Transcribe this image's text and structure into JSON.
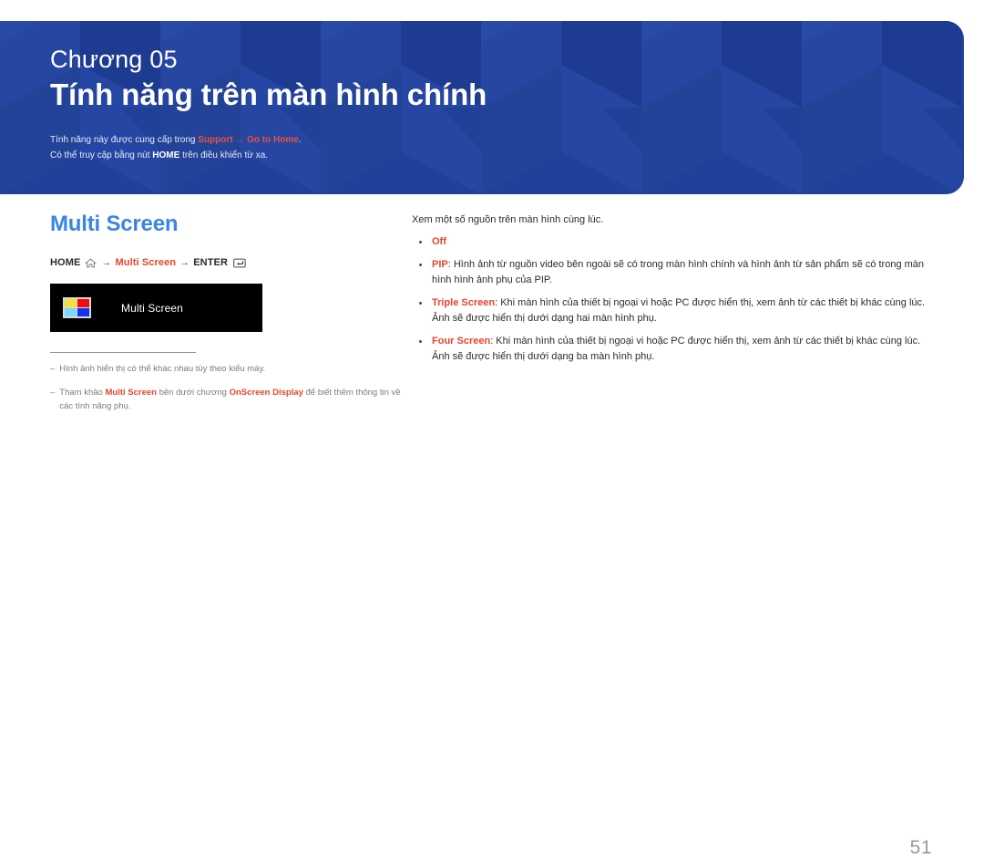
{
  "banner": {
    "chapter_label": "Chương 05",
    "chapter_title": "Tính năng trên màn hình chính",
    "note_line1_pre": "Tính năng này được cung cấp trong ",
    "note_line1_link1": "Support",
    "note_line1_arrow": " → ",
    "note_line1_link2": "Go to Home",
    "note_line1_post": ".",
    "note_line2_pre": "Có thể truy cập bằng nút ",
    "note_line2_bold": "HOME",
    "note_line2_post": " trên điều khiển từ xa.",
    "bg_color": "#21409a",
    "accent_color": "#e8543a"
  },
  "left": {
    "section_heading": "Multi Screen",
    "section_heading_color": "#3a83e8",
    "nav": {
      "home_label": "HOME",
      "home_icon": "home-icon",
      "arrow1": "→",
      "target": "Multi Screen",
      "arrow2": "→",
      "enter_label": "ENTER",
      "enter_icon": "enter-key-icon"
    },
    "osd": {
      "label": "Multi Screen",
      "icon_colors": {
        "top_left": "#f7e03c",
        "top_right": "#f40c0c",
        "bottom_left": "#7fd8f7",
        "bottom_right": "#1430f0"
      },
      "background": "#000000"
    },
    "footnotes": [
      {
        "dash": "‒",
        "parts": [
          {
            "text": "Hình ảnh hiển thị có thể khác nhau tùy theo kiểu máy.",
            "style": "plain"
          }
        ]
      },
      {
        "dash": "‒",
        "parts": [
          {
            "text": "Tham khảo ",
            "style": "plain"
          },
          {
            "text": "Multi Screen",
            "style": "red"
          },
          {
            "text": " bên dưới chương ",
            "style": "plain"
          },
          {
            "text": "OnScreen Display",
            "style": "red"
          },
          {
            "text": " để biết thêm thông tin về các tính năng phụ.",
            "style": "plain"
          }
        ]
      }
    ]
  },
  "right": {
    "intro": "Xem một số nguồn trên màn hình cùng lúc.",
    "bullets": [
      {
        "term": "Off",
        "desc": ""
      },
      {
        "term": "PIP",
        "desc": ": Hình ảnh từ nguồn video bên ngoài sẽ có trong màn hình chính và hình ảnh từ sản phẩm sẽ có trong màn hình hình ảnh phụ của PIP."
      },
      {
        "term": "Triple Screen",
        "desc": ": Khi màn hình của thiết bị ngoại vi hoặc PC được hiển thị, xem ảnh từ các thiết bị khác cùng lúc. Ảnh sẽ được hiển thị dưới dạng hai màn hình phụ."
      },
      {
        "term": "Four Screen",
        "desc": ": Khi màn hình của thiết bị ngoại vi hoặc PC được hiển thị, xem ảnh từ các thiết bị khác cùng lúc. Ảnh sẽ được hiển thị dưới dạng ba màn hình phụ."
      }
    ]
  },
  "footer": {
    "page_number": "51"
  }
}
